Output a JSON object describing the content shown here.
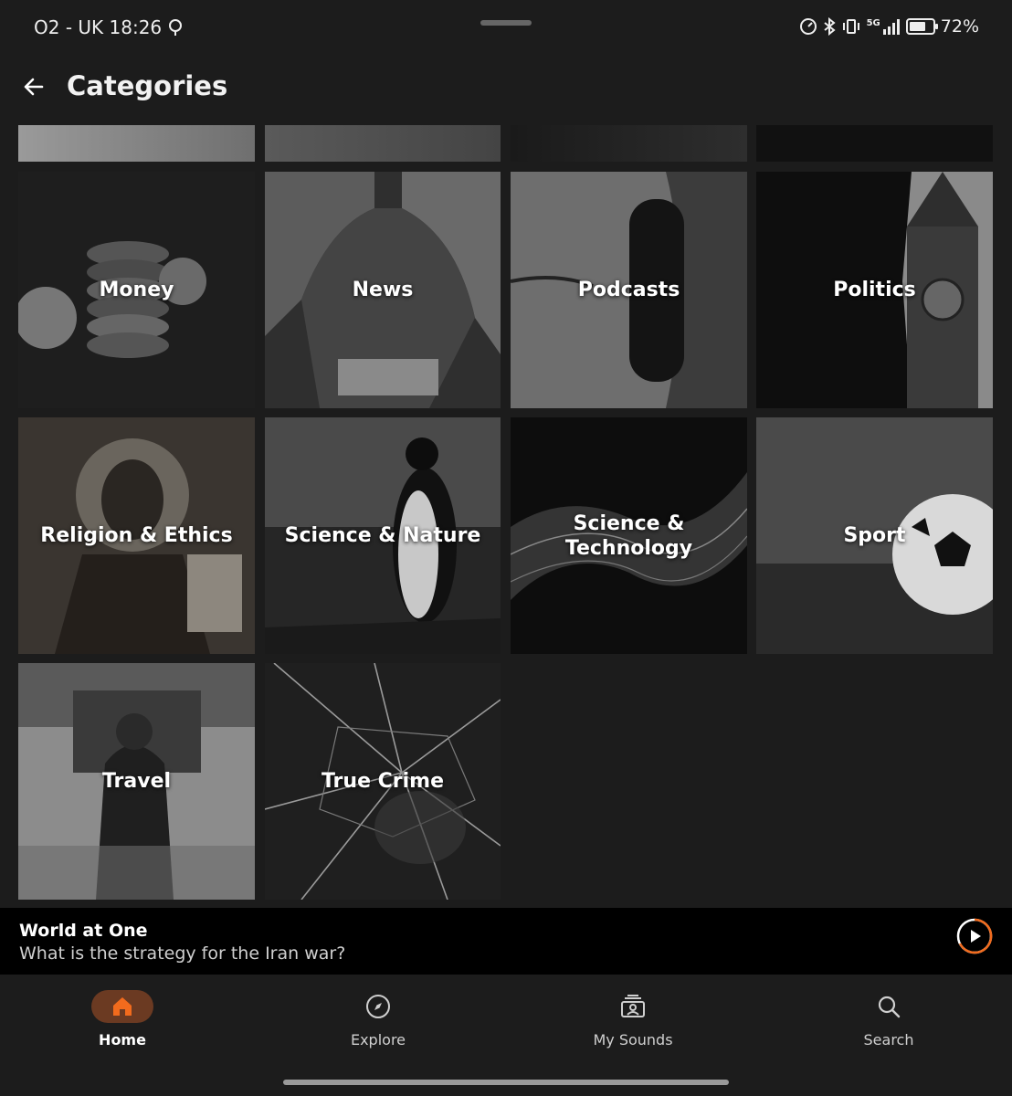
{
  "status_bar": {
    "carrier_time": "O2 - UK 18:26",
    "network": "5G",
    "battery_pct_text": "72%",
    "battery_level": 0.72
  },
  "header": {
    "title": "Categories",
    "back_icon": "arrow-left-icon"
  },
  "categories": [
    {
      "label": "Money",
      "shade": "#262626"
    },
    {
      "label": "News",
      "shade": "#3a3a3a"
    },
    {
      "label": "Podcasts",
      "shade": "#4a4a4a"
    },
    {
      "label": "Politics",
      "shade": "#2a2a2a"
    },
    {
      "label": "Religion & Ethics",
      "shade": "#3b3631"
    },
    {
      "label": "Science & Nature",
      "shade": "#3d3d3d"
    },
    {
      "label": "Science & Technology",
      "shade": "#151515"
    },
    {
      "label": "Sport",
      "shade": "#3e3e3e"
    },
    {
      "label": "Travel",
      "shade": "#555555"
    },
    {
      "label": "True Crime",
      "shade": "#2c2c2c"
    }
  ],
  "mini_player": {
    "title": "World at One",
    "subtitle": "What is the strategy for the Iran war?",
    "play_icon": "play-circle-icon",
    "accent": "#f26b1d"
  },
  "bottom_nav": [
    {
      "label": "Home",
      "icon": "home-icon",
      "active": true
    },
    {
      "label": "Explore",
      "icon": "compass-icon",
      "active": false
    },
    {
      "label": "My Sounds",
      "icon": "my-sounds-icon",
      "active": false
    },
    {
      "label": "Search",
      "icon": "search-icon",
      "active": false
    }
  ]
}
